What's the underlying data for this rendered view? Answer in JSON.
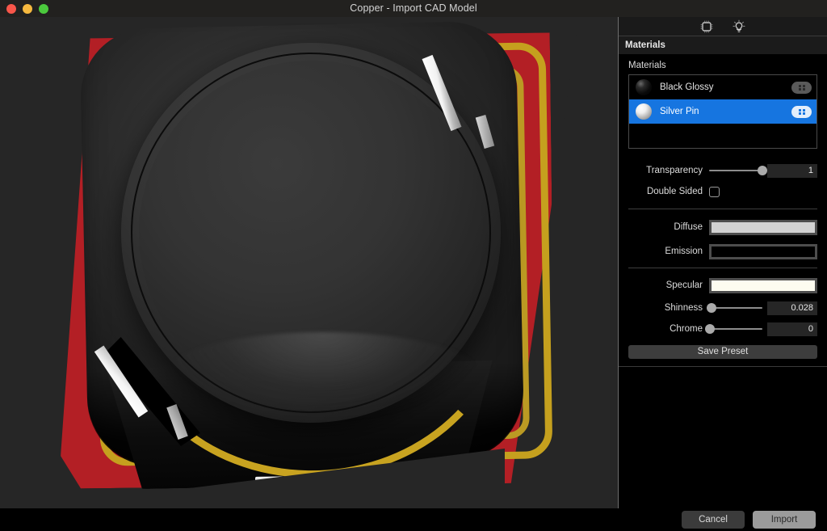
{
  "window": {
    "title": "Copper - Import CAD Model",
    "controls": [
      {
        "name": "close",
        "color": "#f8564a"
      },
      {
        "name": "minimize",
        "color": "#f6b93f"
      },
      {
        "name": "maximize",
        "color": "#4bc93d"
      }
    ]
  },
  "viewport": {
    "description": "3D preview of an imported CAD model: a black glossy round-can component on a red PCB with gold traces and silver pins",
    "background": "#262626",
    "colors": {
      "pcb_red": "#b31f25",
      "trace_gold": "#c8a320",
      "chip_black": "#2e2e2e",
      "pin_silver": "#f2f2f2"
    }
  },
  "panel": {
    "toolbar": {
      "icons": [
        {
          "name": "chip-icon",
          "label": "Model"
        },
        {
          "name": "bulb-icon",
          "label": "Lighting"
        }
      ]
    },
    "header_title": "Materials",
    "group_label": "Materials",
    "materials": [
      {
        "name": "Black Glossy",
        "thumb": "black-sphere",
        "selected": false,
        "action_icon": "grid-icon"
      },
      {
        "name": "Silver Pin",
        "thumb": "silver-sphere",
        "selected": true,
        "action_icon": "grid-icon"
      }
    ],
    "properties": {
      "transparency": {
        "label": "Transparency",
        "value": "1",
        "slider_pct": 100
      },
      "double_sided": {
        "label": "Double Sided",
        "checked": false
      },
      "diffuse": {
        "label": "Diffuse",
        "color": "#d2d2d2"
      },
      "emission": {
        "label": "Emission",
        "color": "#000000"
      },
      "specular": {
        "label": "Specular",
        "color": "#fdfcf0"
      },
      "shinness": {
        "label": "Shinness",
        "value": "0.028",
        "slider_pct": 3
      },
      "chrome": {
        "label": "Chrome",
        "value": "0",
        "slider_pct": 0
      }
    },
    "save_preset_label": "Save Preset",
    "accent_color": "#1675e0"
  },
  "footer": {
    "cancel_label": "Cancel",
    "import_label": "Import"
  }
}
